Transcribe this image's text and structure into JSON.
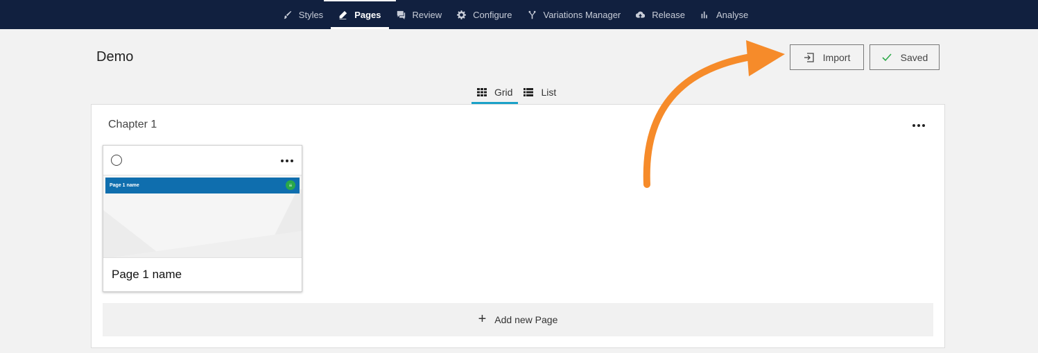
{
  "nav": {
    "items": [
      {
        "label": "Styles",
        "icon": "brush-icon"
      },
      {
        "label": "Pages",
        "icon": "pencil-icon"
      },
      {
        "label": "Review",
        "icon": "comment-icon"
      },
      {
        "label": "Configure",
        "icon": "gear-icon"
      },
      {
        "label": "Variations Manager",
        "icon": "branch-icon"
      },
      {
        "label": "Release",
        "icon": "cloud-upload-icon"
      },
      {
        "label": "Analyse",
        "icon": "bar-chart-icon"
      }
    ],
    "active": "Pages",
    "background": "#11203f"
  },
  "header": {
    "title": "Demo",
    "import_label": "Import",
    "saved_label": "Saved"
  },
  "view": {
    "grid_label": "Grid",
    "list_label": "List",
    "active": "Grid",
    "accent": "#1aa1c8"
  },
  "chapter": {
    "title": "Chapter 1",
    "pages": [
      {
        "name": "Page 1 name",
        "thumb_title": "Page 1 name",
        "thumb_color": "#0f6eae"
      }
    ],
    "add_page_label": "Add new Page"
  },
  "annotation": {
    "arrow_color": "#f68b2a"
  }
}
